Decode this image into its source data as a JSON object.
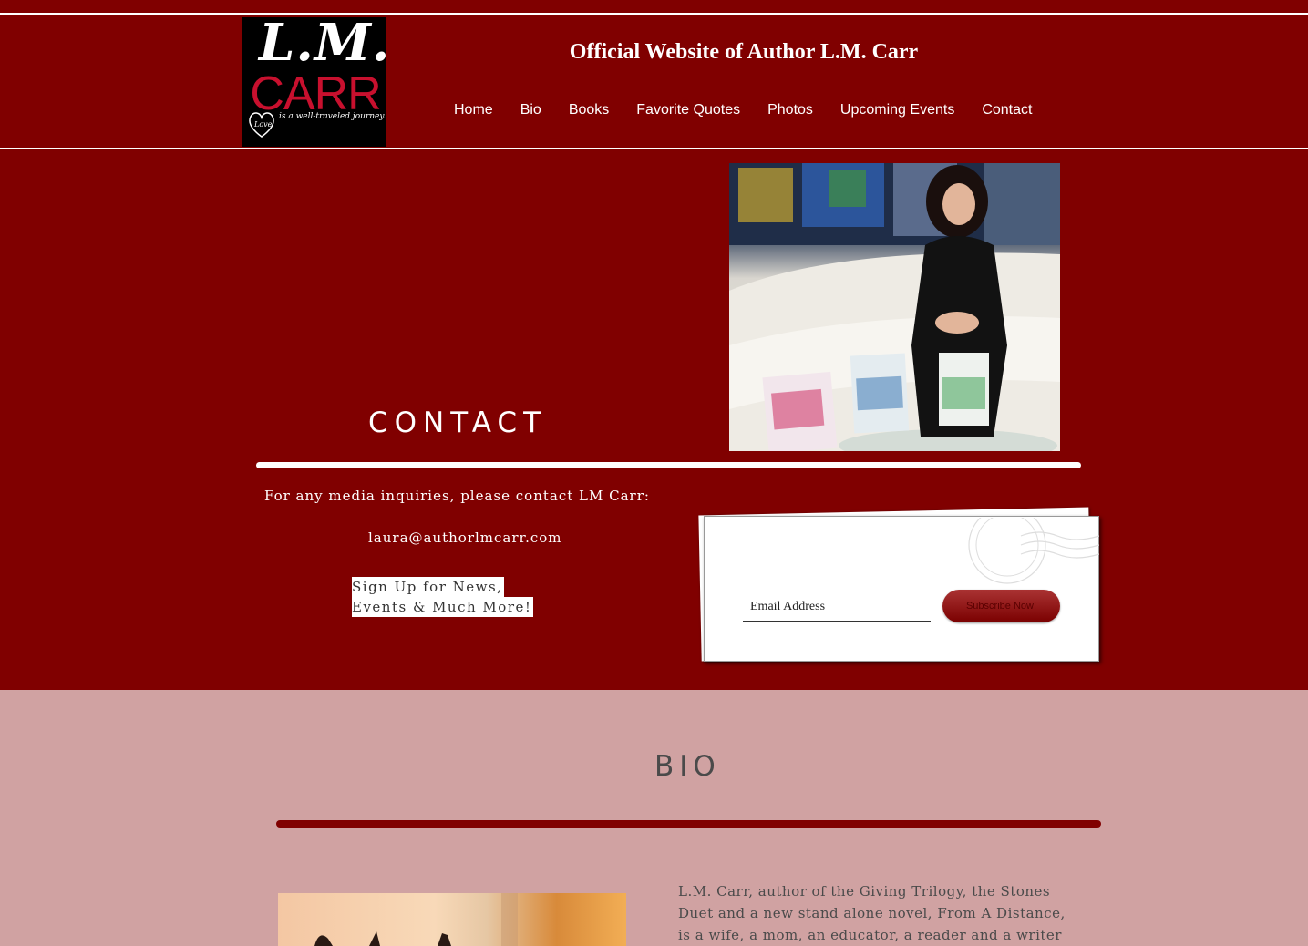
{
  "header": {
    "logo": {
      "line1": "L.M.",
      "line2": "CARR",
      "heart_word": "Love",
      "tagline": "is a well-traveled journey."
    },
    "title": "Official Website of Author L.M. Carr",
    "nav": [
      {
        "label": "Home"
      },
      {
        "label": "Bio"
      },
      {
        "label": "Books"
      },
      {
        "label": "Favorite Quotes"
      },
      {
        "label": "Photos"
      },
      {
        "label": "Upcoming Events"
      },
      {
        "label": "Contact"
      }
    ]
  },
  "contact": {
    "heading": "CONTACT",
    "media_text": "For any media inquiries, please contact LM Carr:",
    "email": "laura@authorlmcarr.com",
    "signup_line1": "Sign Up for News,",
    "signup_line2": "Events & Much More!",
    "form": {
      "email_placeholder": "Email Address",
      "subscribe_label": "Subscribe Now!"
    }
  },
  "bio": {
    "heading": "BIO",
    "text_line1": "L.M. Carr, author of the Giving Trilogy, the Stones",
    "text_line2": "Duet and a new stand alone novel, From A Distance,",
    "text_line3": "is a wife, a mom, an educator, a reader and a writer"
  },
  "colors": {
    "primary": "#800000",
    "bio_background": "#d0a2a2",
    "text_light": "#ffffff",
    "text_dark": "#4a4a4a"
  }
}
